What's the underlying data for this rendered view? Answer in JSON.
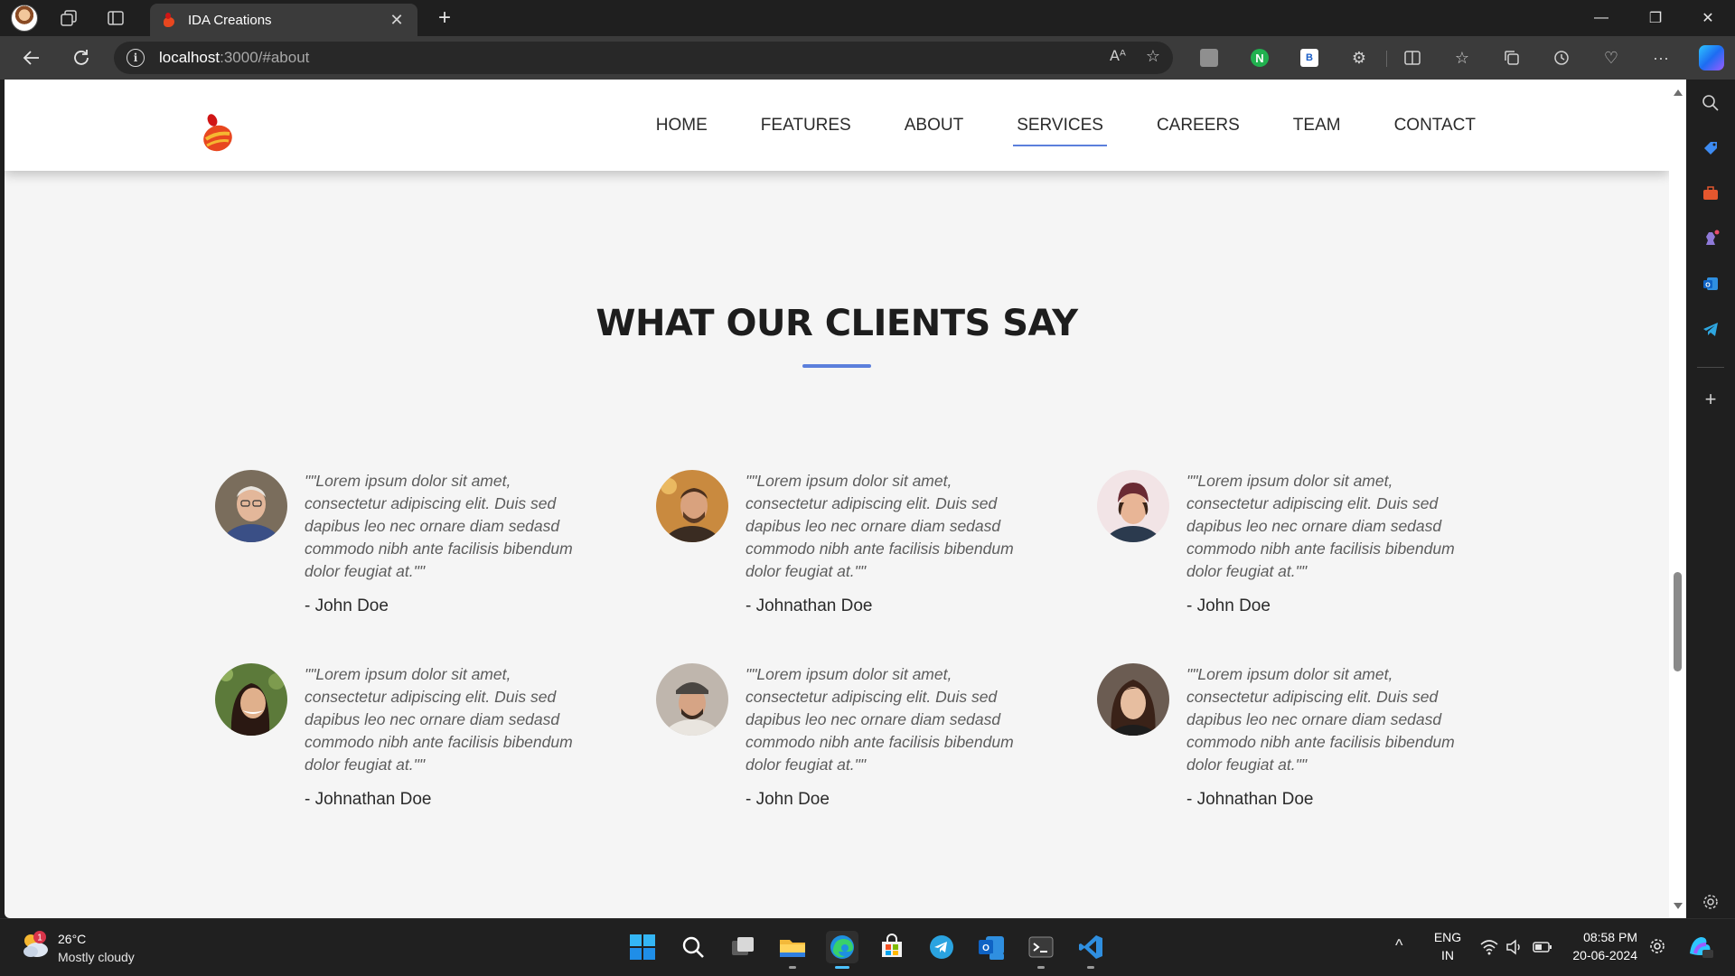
{
  "browser": {
    "tab_title": "IDA Creations",
    "tab_close": "✕",
    "new_tab": "+",
    "url_host": "localhost",
    "url_rest": ":3000/#about",
    "window_controls": {
      "minimize": "—",
      "maximize": "❐",
      "close": "✕"
    }
  },
  "site": {
    "nav": [
      "HOME",
      "FEATURES",
      "ABOUT",
      "SERVICES",
      "CAREERS",
      "TEAM",
      "CONTACT"
    ],
    "active_nav": "SERVICES",
    "section_title": "WHAT OUR CLIENTS SAY",
    "testimonials": [
      {
        "quote": "\"\"Lorem ipsum dolor sit amet, consectetur adipiscing elit. Duis sed dapibus leo nec ornare diam sedasd commodo nibh ante facilisis bibendum dolor feugiat at.\"\"",
        "author": "- John Doe"
      },
      {
        "quote": "\"\"Lorem ipsum dolor sit amet, consectetur adipiscing elit. Duis sed dapibus leo nec ornare diam sedasd commodo nibh ante facilisis bibendum dolor feugiat at.\"\"",
        "author": "- Johnathan Doe"
      },
      {
        "quote": "\"\"Lorem ipsum dolor sit amet, consectetur adipiscing elit. Duis sed dapibus leo nec ornare diam sedasd commodo nibh ante facilisis bibendum dolor feugiat at.\"\"",
        "author": "- John Doe"
      },
      {
        "quote": "\"\"Lorem ipsum dolor sit amet, consectetur adipiscing elit. Duis sed dapibus leo nec ornare diam sedasd commodo nibh ante facilisis bibendum dolor feugiat at.\"\"",
        "author": "- Johnathan Doe"
      },
      {
        "quote": "\"\"Lorem ipsum dolor sit amet, consectetur adipiscing elit. Duis sed dapibus leo nec ornare diam sedasd commodo nibh ante facilisis bibendum dolor feugiat at.\"\"",
        "author": "- John Doe"
      },
      {
        "quote": "\"\"Lorem ipsum dolor sit amet, consectetur adipiscing elit. Duis sed dapibus leo nec ornare diam sedasd commodo nibh ante facilisis bibendum dolor feugiat at.\"\"",
        "author": "- Johnathan Doe"
      }
    ]
  },
  "taskbar": {
    "weather_badge": "1",
    "weather_temp": "26°C",
    "weather_desc": "Mostly cloudy",
    "lang_line1": "ENG",
    "lang_line2": "IN",
    "time": "08:58 PM",
    "date": "20-06-2024",
    "tray_chevron": "^"
  },
  "colors": {
    "accent": "#5b7fdc",
    "page_bg": "#f5f5f5",
    "chrome_bg": "#1f1f1f",
    "toolbar_bg": "#3b3b3b"
  }
}
